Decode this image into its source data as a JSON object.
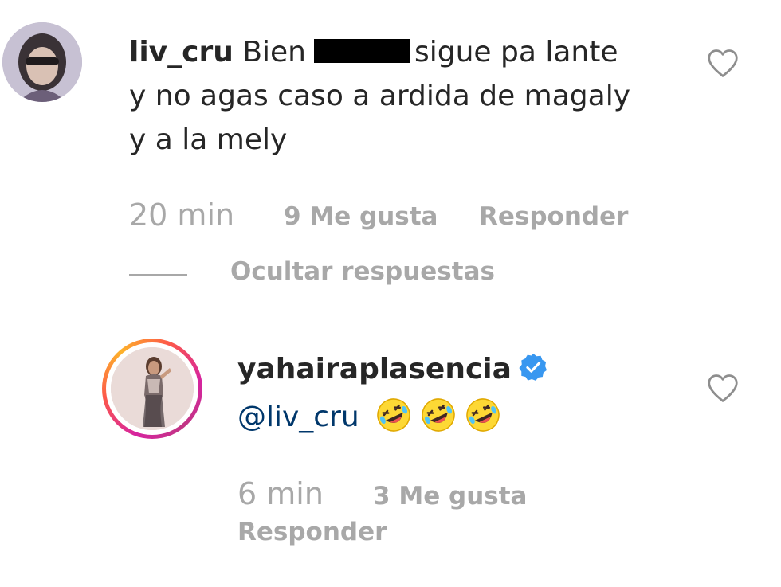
{
  "comment": {
    "username": "liv_cru",
    "text_before": "Bien",
    "text_after": "sigue pa lante",
    "text_line2": "y no agas caso a ardida de magaly",
    "text_line3": "y a la mely",
    "time": "20 min",
    "likes": "9 Me gusta",
    "reply_label": "Responder",
    "hide_replies_label": "Ocultar respuestas"
  },
  "reply": {
    "username": "yahairaplasencia",
    "verified": true,
    "mention": "@liv_cru",
    "emojis": [
      "rolling-on-floor-laughing",
      "rolling-on-floor-laughing",
      "rolling-on-floor-laughing"
    ],
    "time": "6 min",
    "likes": "3 Me gusta",
    "reply_label": "Responder"
  },
  "colors": {
    "text": "#262626",
    "secondary": "#a8a8a8",
    "mention": "#00376b",
    "verified": "#3897f0",
    "story_ring": "#d6249f"
  }
}
